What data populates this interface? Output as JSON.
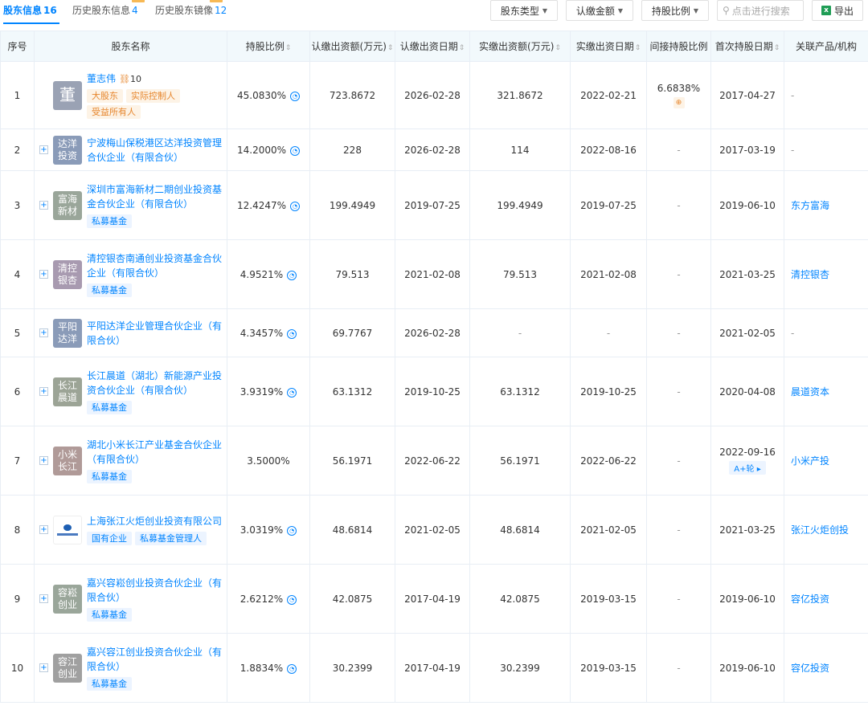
{
  "tabs": [
    {
      "label": "股东信息",
      "count": "16",
      "active": true
    },
    {
      "label": "历史股东信息",
      "count": "4",
      "active": false
    },
    {
      "label": "历史股东镜像",
      "count": "12",
      "active": false
    }
  ],
  "toolbar": {
    "shareholder_type": "股东类型",
    "subscribed_amount": "认缴金额",
    "holding_ratio": "持股比例",
    "search_placeholder": "点击进行搜索",
    "export": "导出"
  },
  "columns": [
    "序号",
    "股东名称",
    "持股比例",
    "认缴出资额(万元)",
    "认缴出资日期",
    "实缴出资额(万元)",
    "实缴出资日期",
    "间接持股比例",
    "首次持股日期",
    "关联产品/机构"
  ],
  "rows": [
    {
      "no": "1",
      "logo": "董",
      "logo_color": "#9aa2b4",
      "name": "董志伟",
      "relations": "10",
      "tags": [
        {
          "text": "大股东",
          "style": "orange"
        },
        {
          "text": "实际控制人",
          "style": "orange"
        },
        {
          "text": "受益所有人",
          "style": "orange"
        }
      ],
      "ratio": "45.0830%",
      "sub_amount": "723.8672",
      "sub_date": "2026-02-28",
      "paid_amount": "321.8672",
      "paid_date": "2022-02-21",
      "indirect": "6.6838%",
      "first_date": "2017-04-27",
      "product": "-"
    },
    {
      "no": "2",
      "logo": "达洋投资",
      "logo_color": "#8a9bb8",
      "name": "宁波梅山保税港区达洋投资管理合伙企业（有限合伙）",
      "tags": [],
      "ratio": "14.2000%",
      "sub_amount": "228",
      "sub_date": "2026-02-28",
      "paid_amount": "114",
      "paid_date": "2022-08-16",
      "indirect": "-",
      "first_date": "2017-03-19",
      "product": "-"
    },
    {
      "no": "3",
      "logo": "富海新材",
      "logo_color": "#9aa69a",
      "name": "深圳市富海新材二期创业投资基金合伙企业（有限合伙）",
      "tags": [
        {
          "text": "私募基金",
          "style": "blue"
        }
      ],
      "ratio": "12.4247%",
      "sub_amount": "199.4949",
      "sub_date": "2019-07-25",
      "paid_amount": "199.4949",
      "paid_date": "2019-07-25",
      "indirect": "-",
      "first_date": "2019-06-10",
      "product": "东方富海"
    },
    {
      "no": "4",
      "logo": "清控银杏",
      "logo_color": "#a89ab0",
      "name": "清控银杏南通创业投资基金合伙企业（有限合伙）",
      "tags": [
        {
          "text": "私募基金",
          "style": "blue"
        }
      ],
      "ratio": "4.9521%",
      "sub_amount": "79.513",
      "sub_date": "2021-02-08",
      "paid_amount": "79.513",
      "paid_date": "2021-02-08",
      "indirect": "-",
      "first_date": "2021-03-25",
      "product": "清控银杏"
    },
    {
      "no": "5",
      "logo": "平阳达洋",
      "logo_color": "#8a9bb8",
      "name": "平阳达洋企业管理合伙企业（有限合伙）",
      "tags": [],
      "ratio": "4.3457%",
      "sub_amount": "69.7767",
      "sub_date": "2026-02-28",
      "paid_amount": "-",
      "paid_date": "-",
      "indirect": "-",
      "first_date": "2021-02-05",
      "product": "-"
    },
    {
      "no": "6",
      "logo": "长江晨道",
      "logo_color": "#9ca496",
      "name": "长江晨道（湖北）新能源产业投资合伙企业（有限合伙）",
      "tags": [
        {
          "text": "私募基金",
          "style": "blue"
        }
      ],
      "ratio": "3.9319%",
      "sub_amount": "63.1312",
      "sub_date": "2019-10-25",
      "paid_amount": "63.1312",
      "paid_date": "2019-10-25",
      "indirect": "-",
      "first_date": "2020-04-08",
      "product": "晨道资本"
    },
    {
      "no": "7",
      "logo": "小米长江",
      "logo_color": "#b09a98",
      "name": "湖北小米长江产业基金合伙企业（有限合伙）",
      "tags": [
        {
          "text": "私募基金",
          "style": "blue"
        }
      ],
      "ratio": "3.5000%",
      "sub_amount": "56.1971",
      "sub_date": "2022-06-22",
      "paid_amount": "56.1971",
      "paid_date": "2022-06-22",
      "indirect": "-",
      "first_date": "2022-09-16",
      "round": "A+轮",
      "product": "小米产投"
    },
    {
      "no": "8",
      "logo": "",
      "logo_color": "#ffffff",
      "name": "上海张江火炬创业投资有限公司",
      "tags": [
        {
          "text": "国有企业",
          "style": "blue"
        },
        {
          "text": "私募基金管理人",
          "style": "blue"
        }
      ],
      "ratio": "3.0319%",
      "sub_amount": "48.6814",
      "sub_date": "2021-02-05",
      "paid_amount": "48.6814",
      "paid_date": "2021-02-05",
      "indirect": "-",
      "first_date": "2021-03-25",
      "product": "张江火炬创投"
    },
    {
      "no": "9",
      "logo": "容崧创业",
      "logo_color": "#9aa69a",
      "name": "嘉兴容崧创业投资合伙企业（有限合伙）",
      "tags": [
        {
          "text": "私募基金",
          "style": "blue"
        }
      ],
      "ratio": "2.6212%",
      "sub_amount": "42.0875",
      "sub_date": "2017-04-19",
      "paid_amount": "42.0875",
      "paid_date": "2019-03-15",
      "indirect": "-",
      "first_date": "2019-06-10",
      "product": "容亿投资"
    },
    {
      "no": "10",
      "logo": "容江创业",
      "logo_color": "#a0a0a0",
      "name": "嘉兴容江创业投资合伙企业（有限合伙）",
      "tags": [
        {
          "text": "私募基金",
          "style": "blue"
        }
      ],
      "ratio": "1.8834%",
      "sub_amount": "30.2399",
      "sub_date": "2017-04-19",
      "paid_amount": "30.2399",
      "paid_date": "2019-03-15",
      "indirect": "-",
      "first_date": "2019-06-10",
      "product": "容亿投资"
    }
  ]
}
